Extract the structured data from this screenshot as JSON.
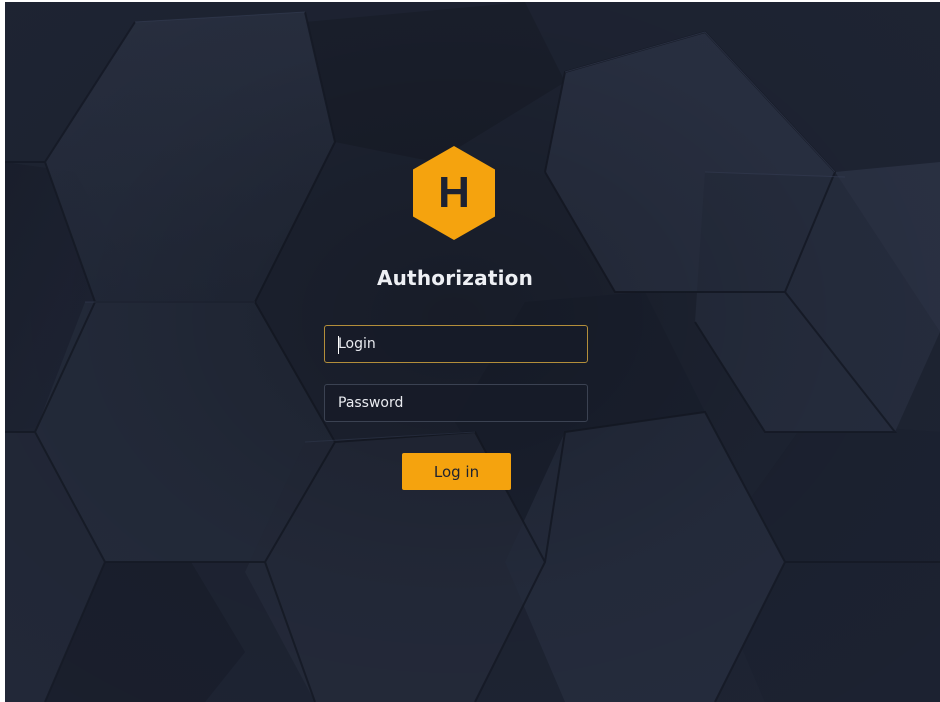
{
  "theme": {
    "background": "#1f2535",
    "accent": "#f5a30e",
    "logo_color": "#f5a30e",
    "focus_border": "#b38e3a"
  },
  "logo": {
    "icon": "hexagon-logo-icon",
    "letter": "H"
  },
  "page": {
    "title": "Authorization"
  },
  "form": {
    "login_placeholder": "Login",
    "login_value": "",
    "password_placeholder": "Password",
    "password_value": "",
    "submit_label": "Log in"
  }
}
